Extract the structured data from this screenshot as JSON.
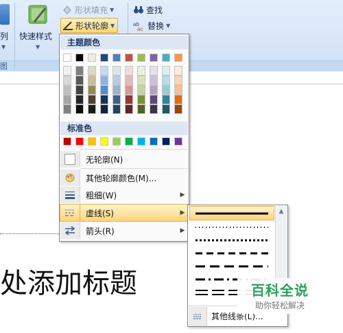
{
  "ribbon": {
    "left_cut_label": "系列",
    "quick_styles_label": "快速样式",
    "shape_fill_label": "形状填充",
    "shape_outline_label": "形状轮廓",
    "find_label": "查找",
    "replace_label": "替换",
    "group_label_left": "图"
  },
  "dropdown": {
    "theme_colors_title": "主题颜色",
    "standard_colors_title": "标准色",
    "theme_top_colors": [
      "#ffffff",
      "#000000",
      "#eeece1",
      "#1f497d",
      "#4f81bd",
      "#c0504d",
      "#9bbb59",
      "#8064a2",
      "#4bacc6",
      "#f79646"
    ],
    "theme_tint_columns": [
      [
        "#f2f2f2",
        "#d9d9d9",
        "#bfbfbf",
        "#a6a6a6",
        "#808080"
      ],
      [
        "#7f7f7f",
        "#595959",
        "#404040",
        "#262626",
        "#0d0d0d"
      ],
      [
        "#ddd9c3",
        "#c4bd97",
        "#938953",
        "#494429",
        "#1d1b10"
      ],
      [
        "#c6d9f0",
        "#8db3e2",
        "#548dd4",
        "#17365d",
        "#0f243e"
      ],
      [
        "#dbe5f1",
        "#b8cce4",
        "#95b3d7",
        "#366092",
        "#244061"
      ],
      [
        "#f2dcdb",
        "#e5b9b7",
        "#d99694",
        "#953734",
        "#632423"
      ],
      [
        "#ebf1dd",
        "#d7e3bc",
        "#c3d69b",
        "#76923c",
        "#4f6128"
      ],
      [
        "#e5e0ec",
        "#ccc1d9",
        "#b2a2c7",
        "#5f497a",
        "#3f3151"
      ],
      [
        "#dbeef3",
        "#b7dde8",
        "#92cddc",
        "#31859b",
        "#205867"
      ],
      [
        "#fdeada",
        "#fbd5b5",
        "#fac08f",
        "#e36c09",
        "#974806"
      ]
    ],
    "standard_colors": [
      "#c00000",
      "#ff0000",
      "#ffc000",
      "#ffff00",
      "#92d050",
      "#00b050",
      "#00b0f0",
      "#0070c0",
      "#002060",
      "#7030a0"
    ],
    "items": [
      {
        "label": "无轮廓(N)",
        "icon": "no-outline-swatch-icon",
        "has_submenu": false
      },
      {
        "label": "其他轮廓颜色(M)...",
        "icon": "palette-icon",
        "has_submenu": false
      },
      {
        "label": "粗细(W)",
        "icon": "line-weight-icon",
        "has_submenu": true
      },
      {
        "label": "虚线(S)",
        "icon": "dash-style-icon",
        "has_submenu": true,
        "active": true
      },
      {
        "label": "箭头(R)",
        "icon": "arrows-icon",
        "has_submenu": true
      }
    ]
  },
  "submenu": {
    "dash_styles": [
      "实线",
      "圆点",
      "方点",
      "短划线",
      "长划线",
      "长短划线",
      "双线"
    ],
    "more_lines_label": "其他线条(L)..."
  },
  "document": {
    "title_placeholder": "处添加标题"
  },
  "watermark": {
    "title": "百科全说",
    "subtitle": "助你轻松解决"
  }
}
